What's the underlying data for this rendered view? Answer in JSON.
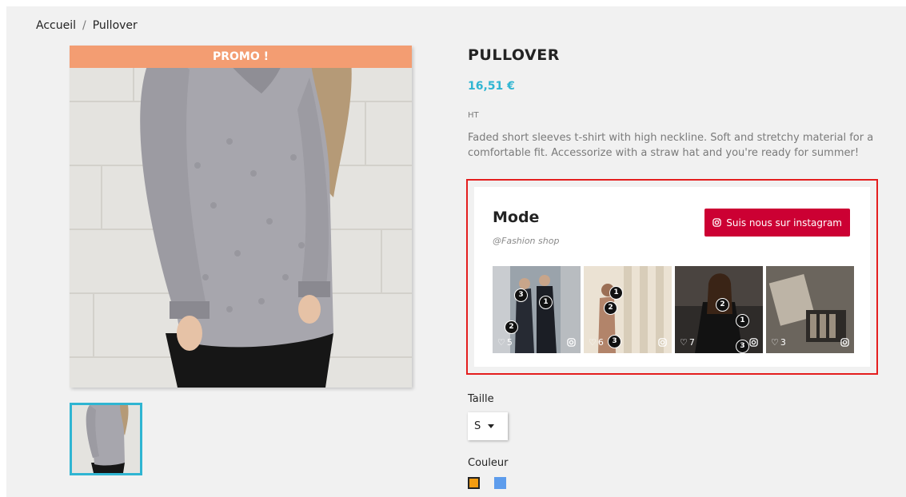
{
  "breadcrumb": {
    "home": "Accueil",
    "separator": "/",
    "current": "Pullover"
  },
  "product": {
    "promo_badge": "PROMO !",
    "title": "PULLOVER",
    "price": "16,51 €",
    "tax_label": "HT",
    "description": "Faded short sleeves t-shirt with high neckline. Soft and stretchy material for a comfortable fit. Accessorize with a straw hat and you're ready for summer!"
  },
  "instagram": {
    "title": "Mode",
    "handle": "@Fashion shop",
    "follow_button": "Suis nous sur instagram",
    "posts": [
      {
        "likes": "5",
        "markers": [
          "3",
          "1",
          "2"
        ]
      },
      {
        "likes": "6",
        "markers": [
          "1",
          "2",
          "3"
        ]
      },
      {
        "likes": "7",
        "markers": [
          "2",
          "1",
          "3"
        ]
      },
      {
        "likes": "3",
        "markers": []
      }
    ]
  },
  "options": {
    "size_label": "Taille",
    "size_value": "S",
    "color_label": "Couleur",
    "colors": [
      {
        "name": "orange-swatch",
        "hex": "#f39c11"
      },
      {
        "name": "blue-swatch",
        "hex": "#5d9cec"
      }
    ]
  },
  "colors": {
    "accent": "#2fb5d2",
    "promo": "#f39d72",
    "instagram_button": "#cc0033",
    "highlight_border": "#e41e1e"
  }
}
